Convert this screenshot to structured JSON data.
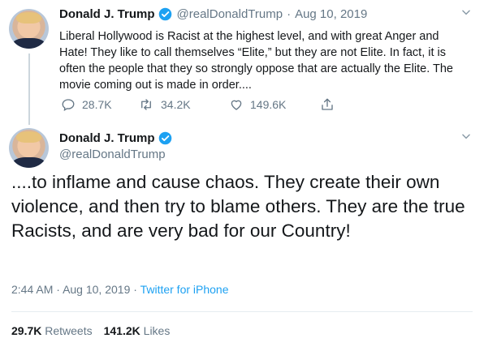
{
  "tweet1": {
    "name": "Donald J. Trump",
    "handle": "@realDonaldTrump",
    "separator": "·",
    "date": "Aug 10, 2019",
    "text": "Liberal Hollywood is Racist at the highest level, and with great Anger and Hate! They like to call themselves “Elite,” but they are not Elite. In fact, it is often the people that they so strongly oppose that are actually the Elite. The movie coming out is made in order....",
    "replies": "28.7K",
    "retweets": "34.2K",
    "likes": "149.6K"
  },
  "tweet2": {
    "name": "Donald J. Trump",
    "handle": "@realDonaldTrump",
    "text": "....to inflame and cause chaos. They create their own violence, and then try to blame others. They are the true Racists, and are very bad for our Country!",
    "time": "2:44 AM",
    "date": "Aug 10, 2019",
    "sep1": "·",
    "sep2": "·",
    "source": "Twitter for iPhone",
    "retweets_count": "29.7K",
    "retweets_label": "Retweets",
    "likes_count": "141.2K",
    "likes_label": "Likes"
  },
  "icons": {
    "verified": "verified-badge-icon",
    "reply": "reply-icon",
    "retweet": "retweet-icon",
    "like": "heart-icon",
    "share": "share-icon",
    "menu": "chevron-down-icon"
  },
  "colors": {
    "accent": "#1da1f2",
    "muted": "#657786",
    "text": "#14171a"
  }
}
